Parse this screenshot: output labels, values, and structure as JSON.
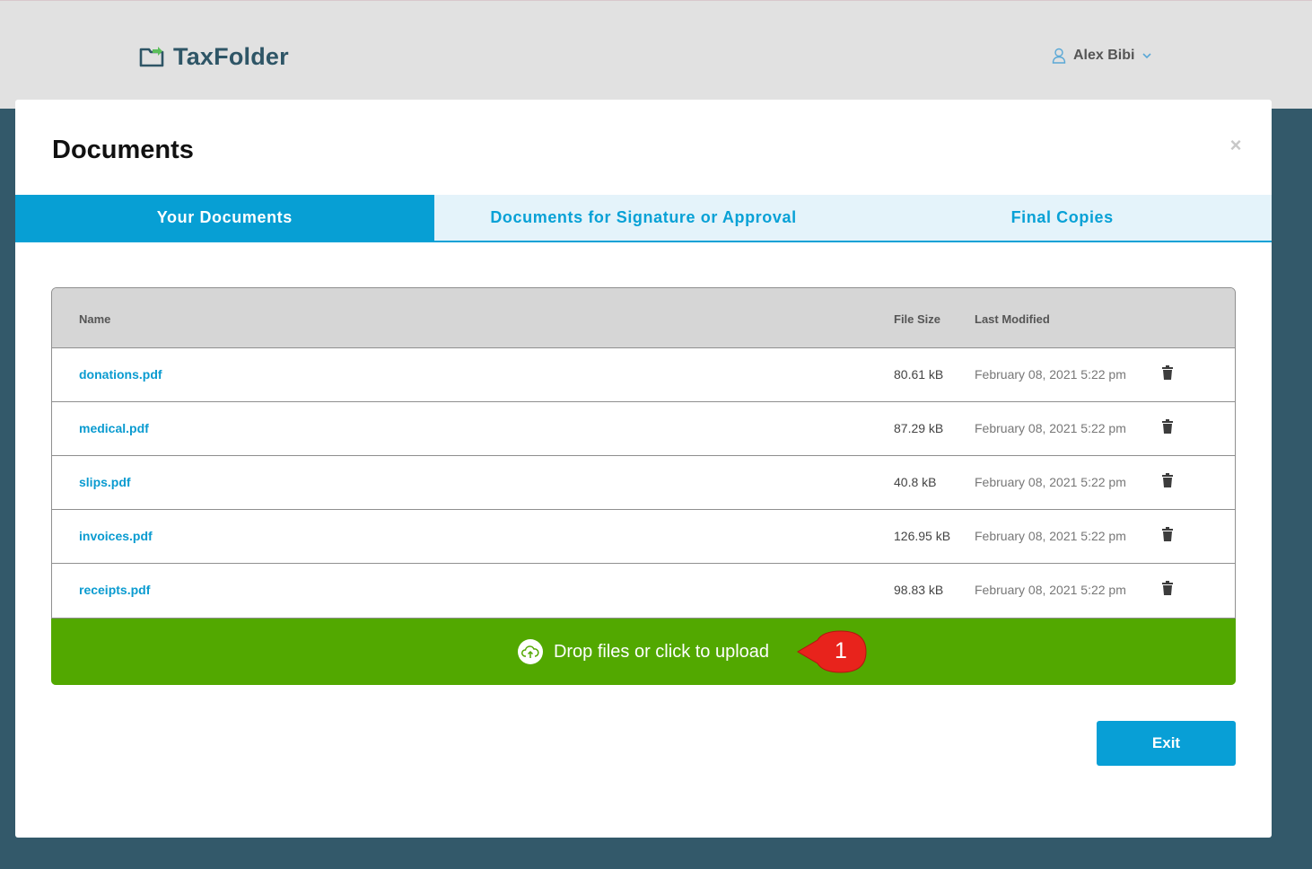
{
  "header": {
    "brand": "TaxFolder",
    "user_name": "Alex Bibi"
  },
  "modal": {
    "title": "Documents",
    "close_symbol": "×",
    "tabs": [
      {
        "label": "Your Documents",
        "active": true
      },
      {
        "label": "Documents for Signature or Approval",
        "active": false
      },
      {
        "label": "Final Copies",
        "active": false
      }
    ],
    "table": {
      "columns": {
        "name": "Name",
        "size": "File Size",
        "modified": "Last Modified"
      },
      "rows": [
        {
          "name": "donations.pdf",
          "size": "80.61 kB",
          "modified": "February 08, 2021 5:22 pm"
        },
        {
          "name": "medical.pdf",
          "size": "87.29 kB",
          "modified": "February 08, 2021 5:22 pm"
        },
        {
          "name": "slips.pdf",
          "size": "40.8 kB",
          "modified": "February 08, 2021 5:22 pm"
        },
        {
          "name": "invoices.pdf",
          "size": "126.95 kB",
          "modified": "February 08, 2021 5:22 pm"
        },
        {
          "name": "receipts.pdf",
          "size": "98.83 kB",
          "modified": "February 08, 2021 5:22 pm"
        }
      ]
    },
    "upload_label": "Drop files or click to upload",
    "callout_number": "1",
    "exit_label": "Exit"
  },
  "icons": [
    "folder-logo-icon",
    "user-icon",
    "chevron-down-icon",
    "close-icon",
    "trash-icon",
    "cloud-upload-icon"
  ],
  "colors": {
    "accent": "#079fd4",
    "upload_green": "#52a800",
    "backdrop": "#33596a",
    "callout_red": "#e8231c"
  }
}
